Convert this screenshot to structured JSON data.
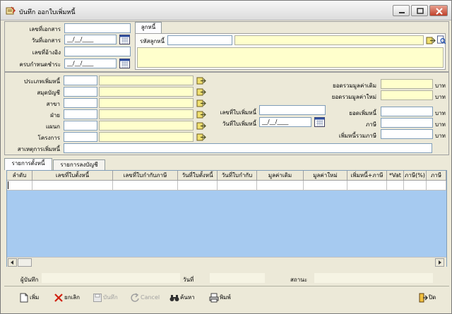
{
  "window": {
    "title": "บันทึก ออกใบเพิ่มหนี้"
  },
  "doc": {
    "doc_no_label": "เลขที่เอกสาร",
    "doc_no_value": "",
    "doc_date_label": "วันที่เอกสาร",
    "doc_date_value": "__/__/____",
    "ref_no_label": "เลขที่อ้างอิง",
    "ref_no_value": "",
    "due_date_label": "ครบกำหนดชำระ",
    "due_date_value": "__/__/____"
  },
  "customer": {
    "tab_label": "ลูกหนี้",
    "code_label": "รหัสลูกหนี้",
    "code_value": ""
  },
  "classify": {
    "type_label": "ประเภทเพิ่มหนี้",
    "book_label": "สมุดบัญชี",
    "branch_label": "สาขา",
    "dept_label": "ฝ่าย",
    "section_label": "แผนก",
    "project_label": "โครงการ",
    "reason_label": "สาเหตุการเพิ่มหนี้"
  },
  "invoice": {
    "no_label": "เลขที่ใบเพิ่มหนี้",
    "date_label": "วันที่ใบเพิ่มหนี้",
    "date_value": "__/__/____"
  },
  "totals": {
    "orig_label": "ยอดรวมมูลค่าเดิม",
    "new_label": "ยอดรวมมูลค่าใหม่",
    "inc_label": "ยอดเพิ่มหนี้",
    "tax_label": "ภาษี",
    "total_label": "เพิ่มหนี้รวมภาษี",
    "unit": "บาท"
  },
  "tabs": [
    "รายการตั้งหนี้",
    "รายการลงบัญชี"
  ],
  "grid": {
    "columns": [
      "ลำดับ",
      "เลขที่ใบตั้งหนี้",
      "เลขที่ใบกำกับภาษี",
      "วันที่ใบตั้งหนี้",
      "วันที่ใบกำกับ",
      "มูลค่าเดิม",
      "มูลค่าใหม่",
      "เพิ่มหนี้+ภาษี",
      "*Vat",
      "ภาษี(%)",
      "ภาษี"
    ]
  },
  "footer": {
    "recorder_label": "ผู้บันทึก",
    "date_label": "วันที่",
    "status_label": "สถานะ"
  },
  "toolbar": {
    "add": "เพิ่ม",
    "cancel_doc": "ยกเลิก",
    "save": "บันทึก",
    "cancel": "Cancel",
    "search": "ค้นหา",
    "print": "พิมพ์",
    "close": "ปิด"
  },
  "colors": {
    "readonly_bg": "#ffffcc",
    "grid_bg": "#a6caf0",
    "window_bg": "#ece9d8"
  },
  "icons": [
    "app-icon",
    "minimize-icon",
    "maximize-icon",
    "close-icon",
    "calendar-icon",
    "lookup-arrow-icon",
    "binoculars-icon",
    "add-doc-icon",
    "x-icon",
    "save-icon",
    "undo-icon",
    "printer-icon",
    "exit-icon"
  ]
}
